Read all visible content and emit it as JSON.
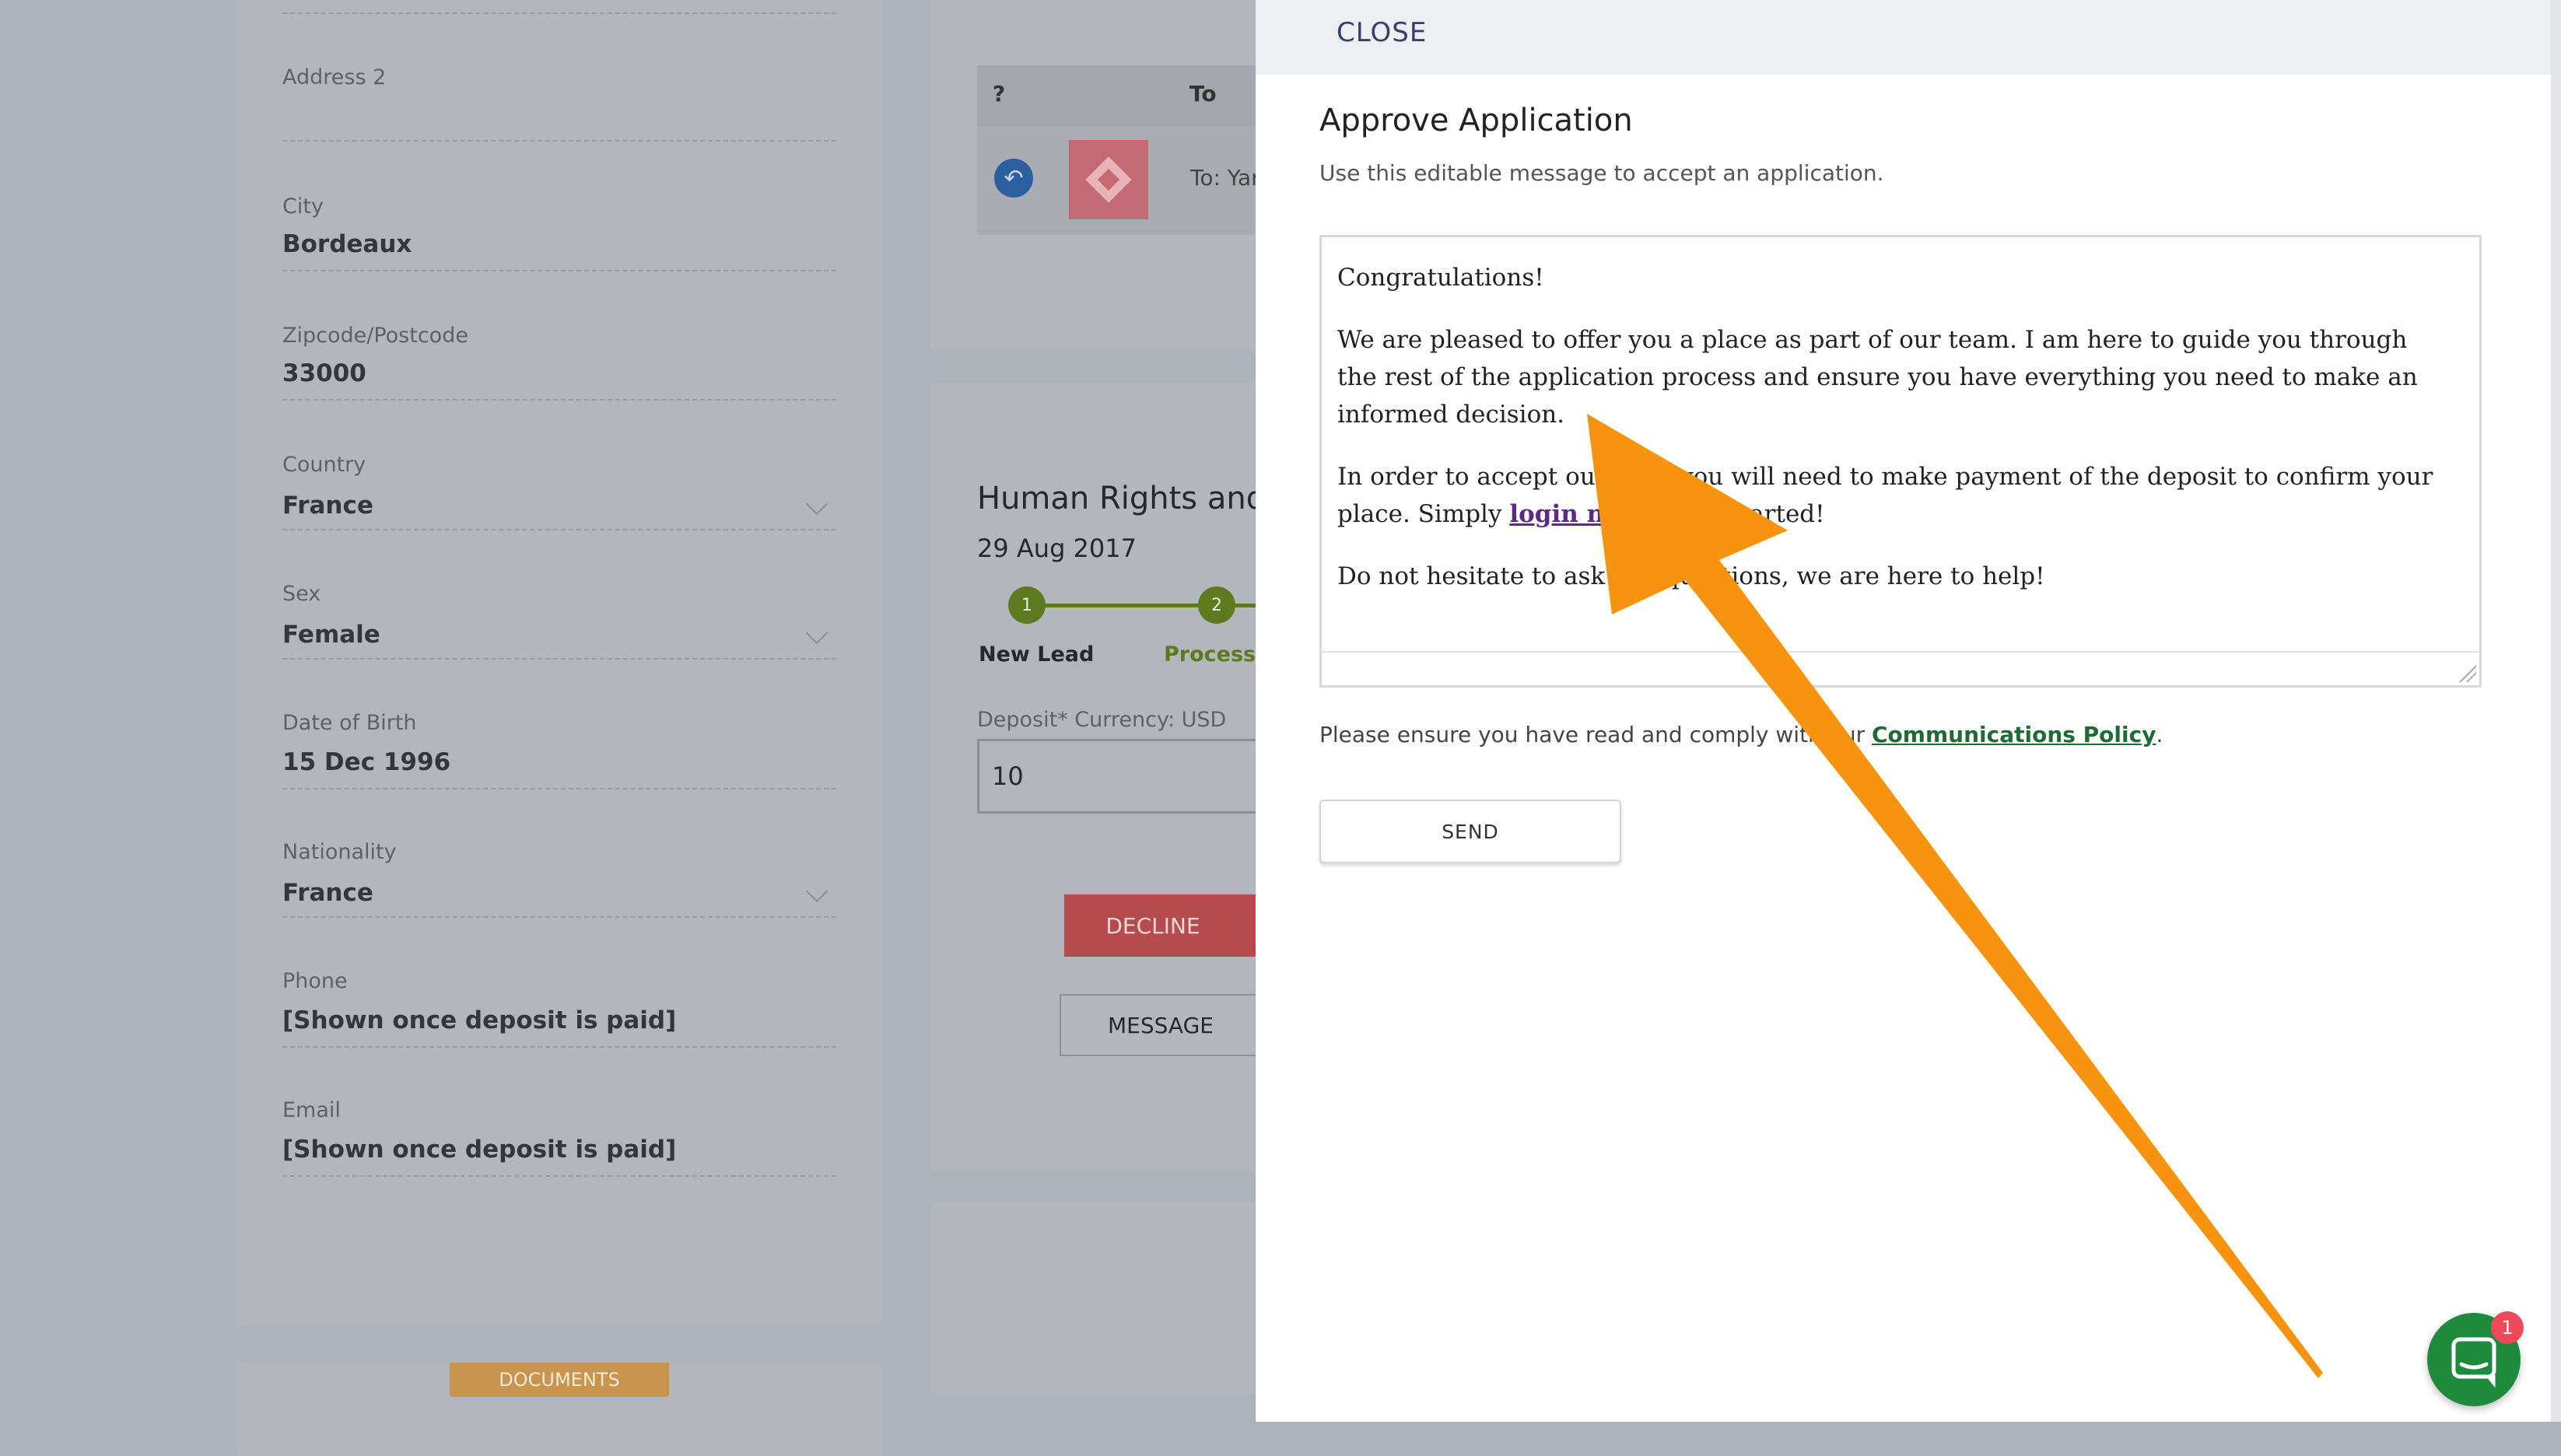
{
  "left_form": {
    "fields": [
      {
        "label": "Address 2",
        "value": ""
      },
      {
        "label": "City",
        "value": "Bordeaux"
      },
      {
        "label": "Zipcode/Postcode",
        "value": "33000"
      },
      {
        "label": "Country",
        "value": "France"
      },
      {
        "label": "Sex",
        "value": "Female"
      },
      {
        "label": "Date of Birth",
        "value": "15 Dec 1996"
      },
      {
        "label": "Nationality",
        "value": "France"
      },
      {
        "label": "Phone",
        "value": "[Shown once deposit is paid]"
      },
      {
        "label": "Email",
        "value": "[Shown once deposit is paid]"
      }
    ],
    "documents_tab": "DOCUMENTS"
  },
  "messages_table": {
    "headers": [
      "?",
      "To"
    ],
    "row_to": "To: Yar"
  },
  "application": {
    "title": "Human Rights and",
    "date": "29 Aug 2017",
    "steps": [
      {
        "num": "1",
        "label": "New Lead"
      },
      {
        "num": "2",
        "label": "Processin"
      }
    ],
    "deposit_label": "Deposit* Currency: USD",
    "deposit_value": "10",
    "decline_label": "DECLINE",
    "message_label": "MESSAGE"
  },
  "panel": {
    "close_label": "CLOSE",
    "title": "Approve Application",
    "subtitle": "Use this editable message to accept an application.",
    "message": {
      "p1": "Congratulations!",
      "p2": "We are pleased to offer you a place as part of our team. I am here to guide you through the rest of the application process and ensure you have everything you need to make an informed decision.",
      "p3_before": "In order to accept our offer you will need to make payment of the deposit to confirm your place. Simply ",
      "p3_link": "login now",
      "p3_after": " to get started!",
      "p4": "Do not hesitate to ask any questions, we are here to help!"
    },
    "policy_before": "Please ensure you have read and comply with our ",
    "policy_link": "Communications Policy",
    "policy_after": ".",
    "send_label": "SEND"
  },
  "chat": {
    "badge_count": "1"
  },
  "colors": {
    "overlay_arrow": "#f7930f",
    "step_green": "#6b8e23",
    "decline_red": "#d9534f",
    "policy_link": "#1f6b35",
    "chat_green": "#1d8a3c"
  }
}
